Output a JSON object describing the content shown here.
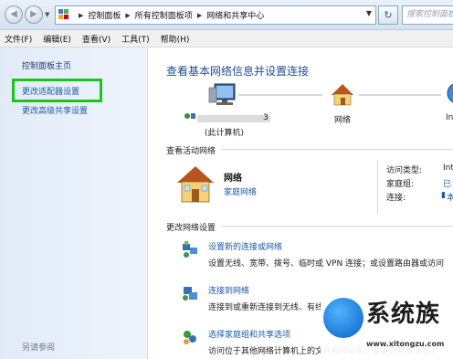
{
  "address_bar": {
    "breadcrumbs": [
      "控制面板",
      "所有控制面板项",
      "网络和共享中心"
    ],
    "search_placeholder": "搜索控制面板"
  },
  "menu": [
    "文件(F)",
    "编辑(E)",
    "查看(V)",
    "工具(T)",
    "帮助(H)"
  ],
  "left_panel": {
    "home": "控制面板主页",
    "links": [
      "更改适配器设置",
      "更改高级共享设置"
    ],
    "see_also": "另请参阅"
  },
  "main": {
    "title": "查看基本网络信息并设置连接",
    "map": {
      "computer_label": "(此计算机)",
      "computer_suffix": "3",
      "network_label": "网络",
      "internet_label": "In"
    },
    "active_section": "查看活动网络",
    "active_network": {
      "name": "网络",
      "type": "家庭网络",
      "details": [
        {
          "key": "访问类型:",
          "value": "Int"
        },
        {
          "key": "家庭组:",
          "value": "已"
        },
        {
          "key": "连接:",
          "value": "本"
        }
      ]
    },
    "change_section": "更改网络设置",
    "tasks": [
      {
        "link": "设置新的连接或网络",
        "desc": "设置无线、宽带、拨号、临时或 VPN 连接；或设置路由器或访问"
      },
      {
        "link": "连接到网络",
        "desc": "连接到或重新连接到无线、有线、拨号或 VPN 网络连接。"
      },
      {
        "link": "选择家庭组和共享选项",
        "desc": "访问位于其他网络计算机上的文件和打印机，或更改共享设置。"
      }
    ]
  },
  "watermark": {
    "text": "系统族",
    "url": "www.xitongzu.com"
  },
  "colors": {
    "highlight": "#1ec31e",
    "link": "#1e5aa8",
    "title": "#1f4e96"
  }
}
